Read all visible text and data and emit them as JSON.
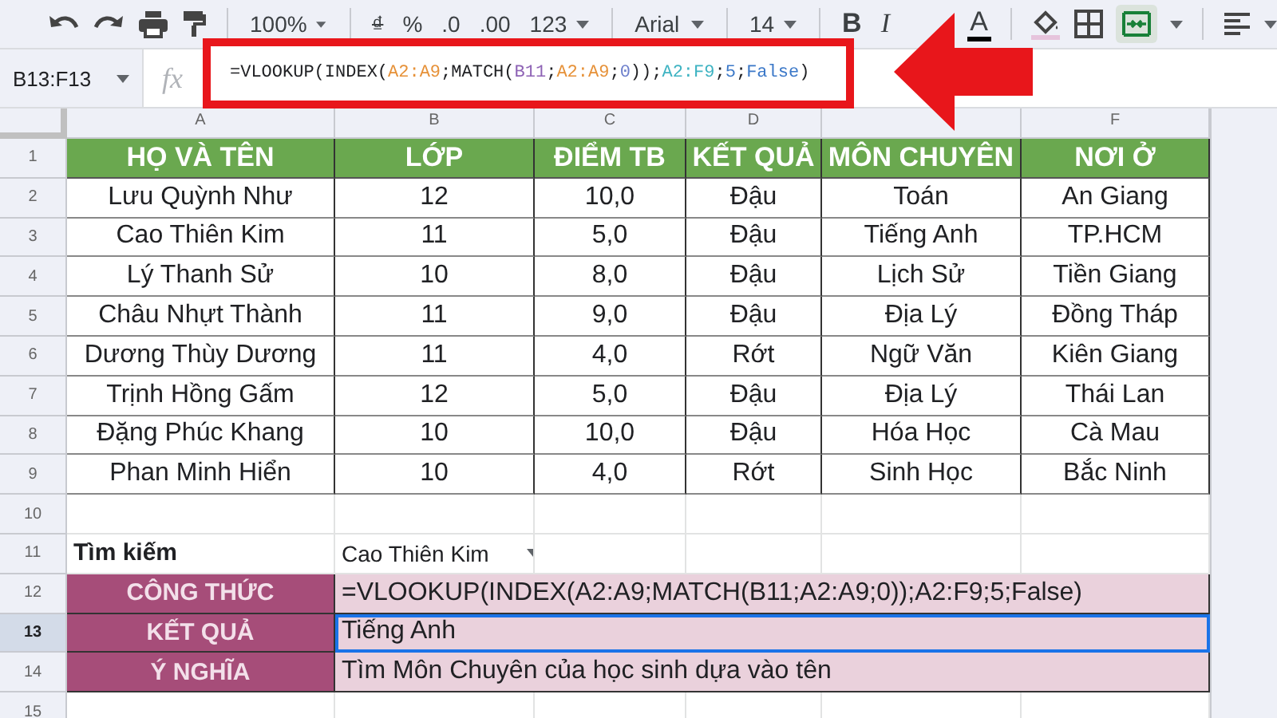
{
  "toolbar": {
    "zoom": "100%",
    "currency": "₫",
    "percent": "%",
    "decimal_less": ".0",
    "decimal_more": ".00",
    "number_format": "123",
    "font": "Arial",
    "font_size": "14",
    "bold": "B",
    "italic": "I",
    "text_color": "A"
  },
  "formula_bar": {
    "name_box": "B13:F13",
    "fx": "fx",
    "tokens": [
      {
        "text": "=VLOOKUP(INDEX(",
        "color": "#202124"
      },
      {
        "text": "A2:A9",
        "color": "#e69138"
      },
      {
        "text": ";MATCH(",
        "color": "#202124"
      },
      {
        "text": "B11",
        "color": "#8e63b5"
      },
      {
        "text": ";",
        "color": "#202124"
      },
      {
        "text": "A2:A9",
        "color": "#e69138"
      },
      {
        "text": ";",
        "color": "#202124"
      },
      {
        "text": "0",
        "color": "#6d7fcc"
      },
      {
        "text": "));",
        "color": "#202124"
      },
      {
        "text": "A2:F9",
        "color": "#3eb3c2"
      },
      {
        "text": ";",
        "color": "#202124"
      },
      {
        "text": "5",
        "color": "#3b78c8"
      },
      {
        "text": ";",
        "color": "#202124"
      },
      {
        "text": "False",
        "color": "#3b78c8"
      },
      {
        "text": ")",
        "color": "#202124"
      }
    ]
  },
  "columns": [
    {
      "label": "A"
    },
    {
      "label": "B"
    },
    {
      "label": "C"
    },
    {
      "label": "D"
    },
    {},
    {
      "label": "F"
    }
  ],
  "row_headers": [
    {
      "label": "1",
      "selected": false
    },
    {
      "label": "2",
      "selected": false
    },
    {
      "label": "3",
      "selected": false
    },
    {
      "label": "4",
      "selected": false
    },
    {
      "label": "5",
      "selected": false
    },
    {
      "label": "6",
      "selected": false
    },
    {
      "label": "7",
      "selected": false
    },
    {
      "label": "8",
      "selected": false
    },
    {
      "label": "9",
      "selected": false
    },
    {
      "label": "10",
      "selected": false
    },
    {
      "label": "11",
      "selected": false
    },
    {
      "label": "12",
      "selected": false
    },
    {
      "label": "13",
      "selected": true
    },
    {
      "label": "14",
      "selected": false
    },
    {
      "label": "15",
      "selected": false
    }
  ],
  "table": {
    "headers": [
      "HỌ VÀ TÊN",
      "LỚP",
      "ĐIỂM TB",
      "KẾT QUẢ",
      "MÔN CHUYÊN",
      "NƠI Ở"
    ],
    "rows": [
      [
        "Lưu Quỳnh Như",
        "12",
        "10,0",
        "Đậu",
        "Toán",
        "An Giang"
      ],
      [
        "Cao Thiên Kim",
        "11",
        "5,0",
        "Đậu",
        "Tiếng Anh",
        "TP.HCM"
      ],
      [
        "Lý Thanh Sử",
        "10",
        "8,0",
        "Đậu",
        "Lịch Sử",
        "Tiền Giang"
      ],
      [
        "Châu Nhựt Thành",
        "11",
        "9,0",
        "Đậu",
        "Địa Lý",
        "Đồng Tháp"
      ],
      [
        "Dương Thùy Dương",
        "11",
        "4,0",
        "Rớt",
        "Ngữ Văn",
        "Kiên Giang"
      ],
      [
        "Trịnh Hồng Gấm",
        "12",
        "5,0",
        "Đậu",
        "Địa Lý",
        "Thái Lan"
      ],
      [
        "Đặng Phúc Khang",
        "10",
        "10,0",
        "Đậu",
        "Hóa Học",
        "Cà Mau"
      ],
      [
        "Phan Minh Hiển",
        "10",
        "4,0",
        "Rớt",
        "Sinh Học",
        "Bắc Ninh"
      ]
    ]
  },
  "lookup": {
    "label": "Tìm kiếm",
    "value": "Cao Thiên Kim"
  },
  "summary": [
    {
      "label": "CÔNG THỨC",
      "value": "=VLOOKUP(INDEX(A2:A9;MATCH(B11;A2:A9;0));A2:F9;5;False)",
      "selected": false
    },
    {
      "label": "KẾT QUẢ",
      "value": "Tiếng Anh",
      "selected": true
    },
    {
      "label": "Ý NGHĨA",
      "value": "Tìm Môn Chuyên của học sinh dựa vào tên",
      "selected": false
    }
  ]
}
